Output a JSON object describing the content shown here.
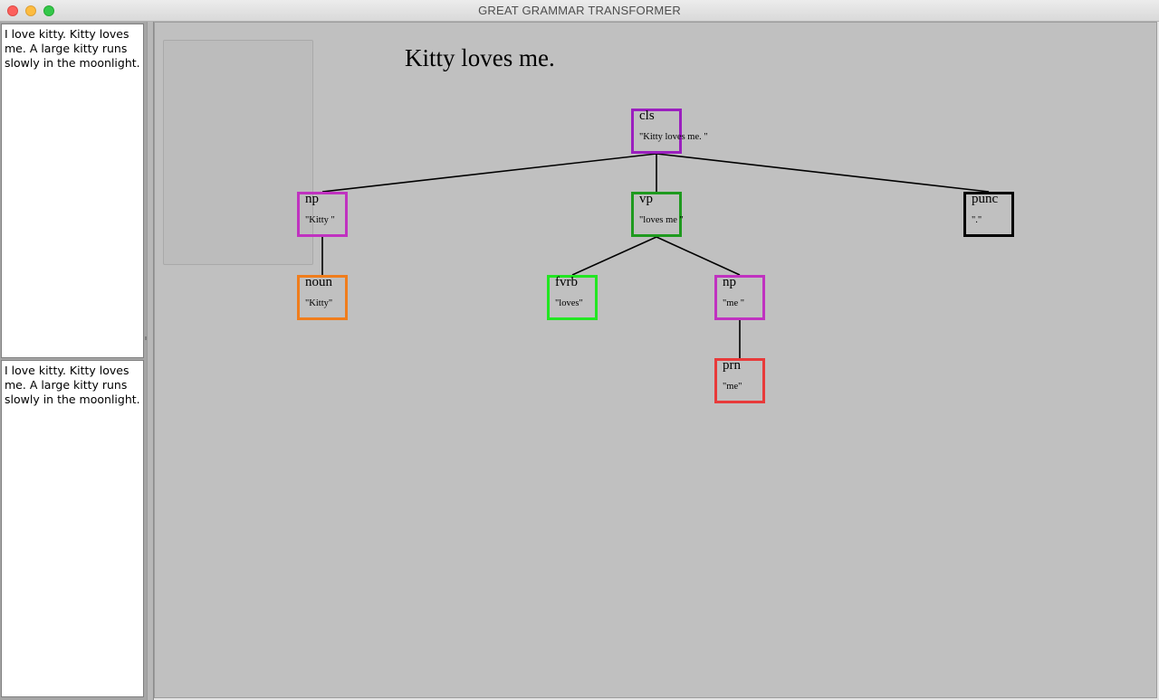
{
  "window": {
    "title": "GREAT GRAMMAR TRANSFORMER"
  },
  "input": {
    "top_text": "I love kitty. Kitty loves me. A large kitty runs slowly in the moonlight.",
    "bottom_text": "I love kitty. Kitty loves me. A large kitty runs slowly in the moonlight."
  },
  "canvas": {
    "sentence": "Kitty loves me."
  },
  "tree": {
    "nodes": [
      {
        "id": "cls",
        "label": "cls",
        "text": "\"Kitty loves me. \"",
        "color": "#9b1fbf"
      },
      {
        "id": "np1",
        "label": "np",
        "text": "\"Kitty \"",
        "color": "#c032c0"
      },
      {
        "id": "vp",
        "label": "vp",
        "text": "\"loves me \"",
        "color": "#1f9a1f"
      },
      {
        "id": "punc",
        "label": "punc",
        "text": "\".\"",
        "color": "#000000"
      },
      {
        "id": "noun",
        "label": "noun",
        "text": "\"Kitty\"",
        "color": "#f07d1c"
      },
      {
        "id": "fvrb",
        "label": "fvrb",
        "text": "\"loves\"",
        "color": "#22e622"
      },
      {
        "id": "np2",
        "label": "np",
        "text": "\"me \"",
        "color": "#c032c0"
      },
      {
        "id": "prn",
        "label": "prn",
        "text": "\"me\"",
        "color": "#e83a3a"
      }
    ],
    "edges": [
      [
        "cls",
        "np1"
      ],
      [
        "cls",
        "vp"
      ],
      [
        "cls",
        "punc"
      ],
      [
        "np1",
        "noun"
      ],
      [
        "vp",
        "fvrb"
      ],
      [
        "vp",
        "np2"
      ],
      [
        "np2",
        "prn"
      ]
    ]
  }
}
